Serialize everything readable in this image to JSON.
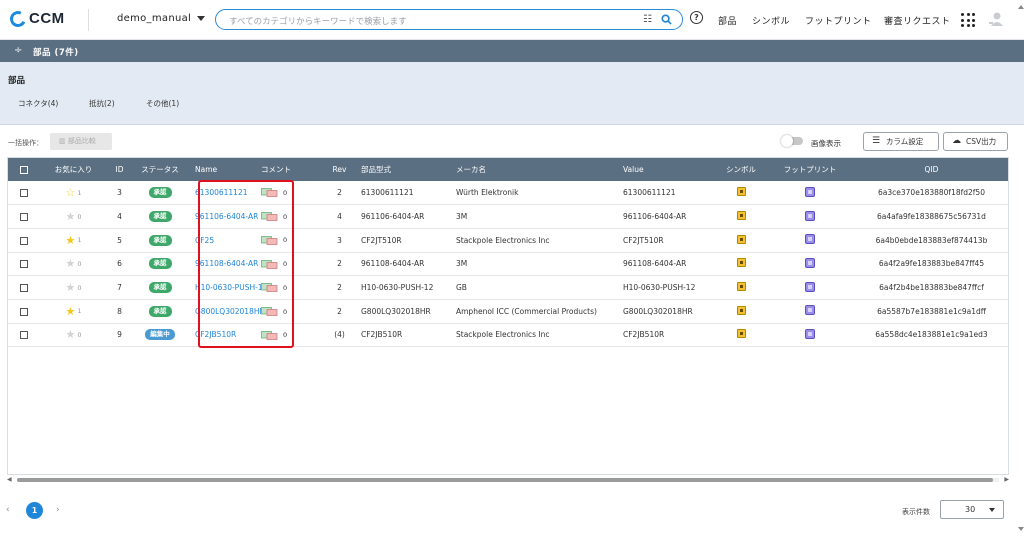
{
  "app": {
    "logo_text": "CCM"
  },
  "header": {
    "project": "demo_manual",
    "search_placeholder": "すべてのカテゴリからキーワードで検索します",
    "nav": [
      "部品",
      "シンボル",
      "フットプリント",
      "審査リクエスト"
    ]
  },
  "banner": {
    "title": "部品 (7件)"
  },
  "categories": {
    "title": "部品",
    "tabs": [
      "コネクタ(4)",
      "抵抗(2)",
      "その他(1)"
    ]
  },
  "toolbar": {
    "bulk_label": "一括操作：",
    "compare_label": "部品比較",
    "image_toggle_label": "画像表示",
    "column_settings_label": "カラム設定",
    "csv_label": "CSV出力"
  },
  "table": {
    "columns": [
      "お気に入り",
      "ID",
      "ステータス",
      "Name",
      "コメント",
      "Rev",
      "部品型式",
      "メーカ名",
      "Value",
      "シンボル",
      "フットプリント",
      "QID"
    ],
    "rows": [
      {
        "fav": "half",
        "fav_count": "1",
        "id": "3",
        "status": "承認",
        "status_type": "approved",
        "name": "61300611121",
        "comments": "0",
        "rev": "2",
        "part_no": "61300611121",
        "maker": "Würth Elektronik",
        "value": "61300611121",
        "qid": "6a3ce370e183880f18fd2f50"
      },
      {
        "fav": "off",
        "fav_count": "0",
        "id": "4",
        "status": "承認",
        "status_type": "approved",
        "name": "961106-6404-AR",
        "comments": "0",
        "rev": "4",
        "part_no": "961106-6404-AR",
        "maker": "3M",
        "value": "961106-6404-AR",
        "qid": "6a4afa9fe18388675c56731d"
      },
      {
        "fav": "on",
        "fav_count": "1",
        "id": "5",
        "status": "承認",
        "status_type": "approved",
        "name": "CF25",
        "comments": "0",
        "rev": "3",
        "part_no": "CF2JT510R",
        "maker": "Stackpole Electronics Inc",
        "value": "CF2JT510R",
        "qid": "6a4b0ebde183883ef874413b"
      },
      {
        "fav": "off",
        "fav_count": "0",
        "id": "6",
        "status": "承認",
        "status_type": "approved",
        "name": "961108-6404-AR",
        "comments": "0",
        "rev": "2",
        "part_no": "961108-6404-AR",
        "maker": "3M",
        "value": "961108-6404-AR",
        "qid": "6a4f2a9fe183883be847ff45"
      },
      {
        "fav": "off",
        "fav_count": "0",
        "id": "7",
        "status": "承認",
        "status_type": "approved",
        "name": "H10-0630-PUSH-12",
        "comments": "0",
        "rev": "2",
        "part_no": "H10-0630-PUSH-12",
        "maker": "GB",
        "value": "H10-0630-PUSH-12",
        "qid": "6a4f2b4be183883be847ffcf"
      },
      {
        "fav": "on",
        "fav_count": "1",
        "id": "8",
        "status": "承認",
        "status_type": "approved",
        "name": "G800LQ302018HR",
        "comments": "0",
        "rev": "2",
        "part_no": "G800LQ302018HR",
        "maker": "Amphenol ICC (Commercial Products)",
        "value": "G800LQ302018HR",
        "qid": "6a5587b7e183881e1c9a1dff"
      },
      {
        "fav": "off",
        "fav_count": "0",
        "id": "9",
        "status": "編集中",
        "status_type": "editing",
        "name": "CF2JB510R",
        "comments": "0",
        "rev": "(4)",
        "part_no": "CF2JB510R",
        "maker": "Stackpole Electronics Inc",
        "value": "CF2JB510R",
        "qid": "6a558dc4e183881e1c9a1ed3"
      }
    ]
  },
  "pagination": {
    "current_page": "1",
    "per_page_label": "表示件数",
    "per_page_value": "30"
  },
  "colors": {
    "accent": "#1f86d8",
    "header_bg": "#5b6f82",
    "approved": "#3ea86a",
    "editing": "#4a9bd3",
    "highlight": "#e0101e"
  }
}
